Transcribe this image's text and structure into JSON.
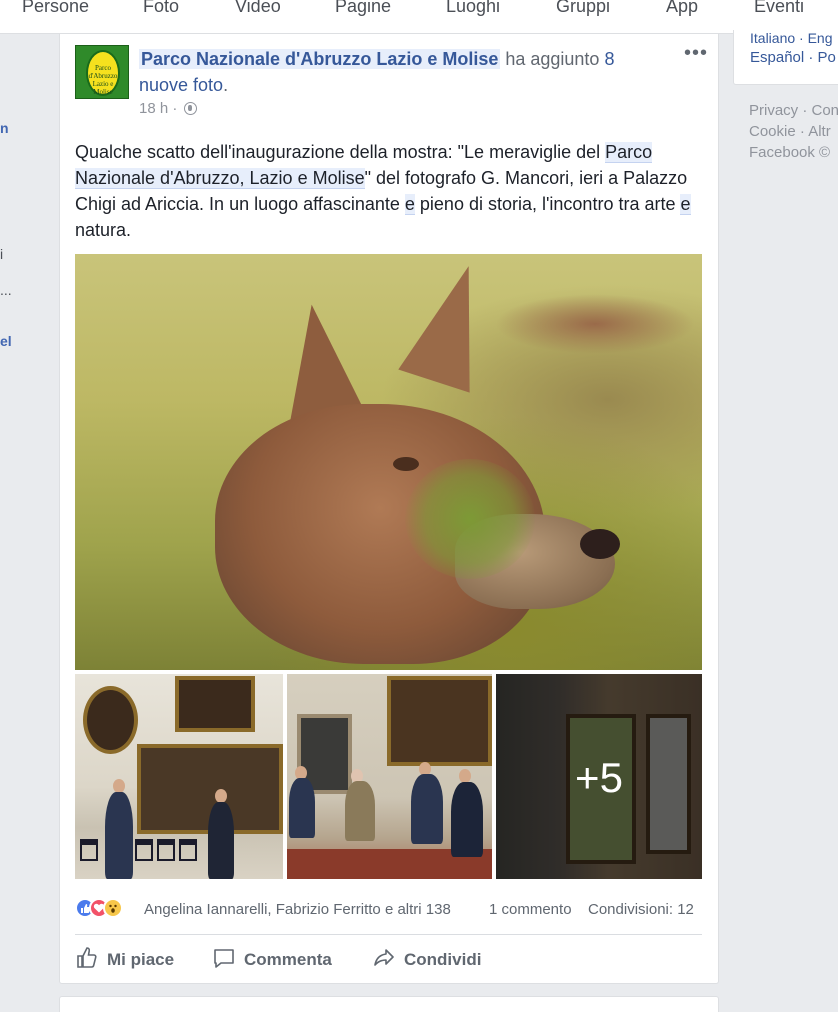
{
  "nav": {
    "tabs": [
      "Persone",
      "Foto",
      "Video",
      "Pagine",
      "Luoghi",
      "Gruppi",
      "App",
      "Eventi"
    ]
  },
  "left_fragments": [
    "n",
    "i",
    "...",
    "el"
  ],
  "right": {
    "languages_line1": "Italiano · Eng",
    "languages_line2": "Español · Po",
    "footer": [
      "Privacy · Con",
      "Cookie · Altr",
      "Facebook ©"
    ]
  },
  "post": {
    "page_name": "Parco Nazionale d'Abruzzo Lazio e Molise",
    "action_text": " ha aggiunto ",
    "photo_count": "8 nuove foto",
    "action_end": ".",
    "time": "18 h · ",
    "more_icon": "more-options-icon",
    "avatar_text": "Parco d'Abruzzo Lazio e Molise",
    "text": {
      "p1": "Qualche scatto dell'inaugurazione della mostra: \"Le meraviglie del ",
      "link1": "Parco Nazionale d'Abruzzo, Lazio e Molise",
      "p2": "\" del fotografo G. Mancori, ieri a Palazzo Chigi ad Ariccia. In un luogo affascinante ",
      "e1": "e",
      "p3": " pieno di storia, l'incontro tra arte ",
      "e2": "e",
      "p4": " natura."
    },
    "more_photos": "+5",
    "reactions": {
      "icons": [
        "like-reaction-icon",
        "love-reaction-icon",
        "wow-reaction-icon"
      ],
      "names": "Angelina Iannarelli, Fabrizio Ferritto e altri 138",
      "comments": "1 commento",
      "shares": "Condivisioni: 12"
    },
    "actions": {
      "like": "Mi piace",
      "comment": "Commenta",
      "share": "Condividi"
    }
  },
  "colors": {
    "link": "#365899",
    "background": "#e9ebee",
    "secondary_text": "#90949c"
  }
}
